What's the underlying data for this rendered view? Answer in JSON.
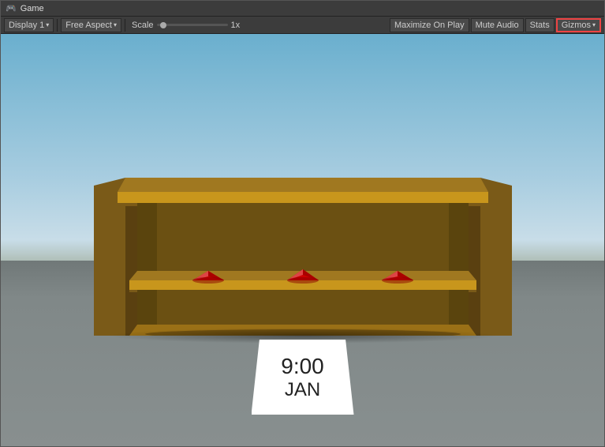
{
  "window": {
    "title": "Game",
    "icon": "game-icon"
  },
  "toolbar": {
    "display_label": "Display 1",
    "display_arrow": "▾",
    "aspect_label": "Free Aspect",
    "aspect_arrow": "▾",
    "scale_prefix": "Scale",
    "scale_value": "1x",
    "maximize_label": "Maximize On Play",
    "mute_label": "Mute Audio",
    "stats_label": "Stats",
    "gizmos_label": "Gizmos",
    "gizmos_arrow": "▾"
  },
  "game_scene": {
    "time": "9:00",
    "month": "JAN"
  },
  "colors": {
    "gizmos_border": "#e44444",
    "sky_top": "#6aafce",
    "sky_bottom": "#c8dde8",
    "shelf_wood": "#8B6914",
    "shelf_shadow": "#5a4010",
    "gem_red": "#cc1111",
    "gem_highlight": "#ff4444"
  }
}
